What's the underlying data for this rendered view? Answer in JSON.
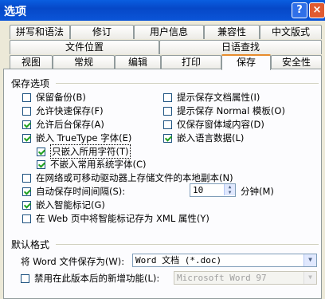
{
  "window": {
    "title": "选项",
    "help_icon": "?",
    "close_icon": "×"
  },
  "tabs_row1": [
    "拼写和语法",
    "修订",
    "用户信息",
    "兼容性",
    "中文版式"
  ],
  "tabs_row2": [
    "文件位置",
    "日语查找"
  ],
  "tabs_row3": [
    "视图",
    "常规",
    "编辑",
    "打印",
    "保存",
    "安全性"
  ],
  "active_tab": "保存",
  "save_options": {
    "title": "保存选项",
    "left": [
      {
        "label": "保留备份(B)",
        "checked": false
      },
      {
        "label": "允许快速保存(F)",
        "checked": false
      },
      {
        "label": "允许后台保存(A)",
        "checked": true
      },
      {
        "label": "嵌入 TrueType 字体(E)",
        "checked": true
      }
    ],
    "right": [
      {
        "label": "提示保存文档属性(I)",
        "checked": false
      },
      {
        "label": "提示保存 Normal 模板(O)",
        "checked": false
      },
      {
        "label": "仅保存窗体域内容(D)",
        "checked": false
      },
      {
        "label": "嵌入语言数据(L)",
        "checked": true
      }
    ],
    "sub": [
      {
        "label": "只嵌入所用字符(T)",
        "checked": true
      },
      {
        "label": "不嵌入常用系统字体(C)",
        "checked": true
      }
    ],
    "network_copy": {
      "label": "在网络或可移动驱动器上存储文件的本地副本(N)",
      "checked": false
    },
    "autosave": {
      "label": "自动保存时间间隔(S):",
      "checked": true,
      "value": "10",
      "unit": "分钟(M)"
    },
    "smart_tags": {
      "label": "嵌入智能标记(G)",
      "checked": true
    },
    "xml_smart_tags": {
      "label": "在 Web 页中将智能标记存为 XML 属性(Y)",
      "checked": false
    }
  },
  "default_format": {
    "title": "默认格式",
    "save_as_label": "将 Word 文件保存为(W):",
    "save_as_value": "Word 文档 (*.doc)",
    "disable_features": {
      "label": "禁用在此版本后的新增功能(L):",
      "checked": false
    },
    "version_value": "Microsoft Word 97"
  }
}
